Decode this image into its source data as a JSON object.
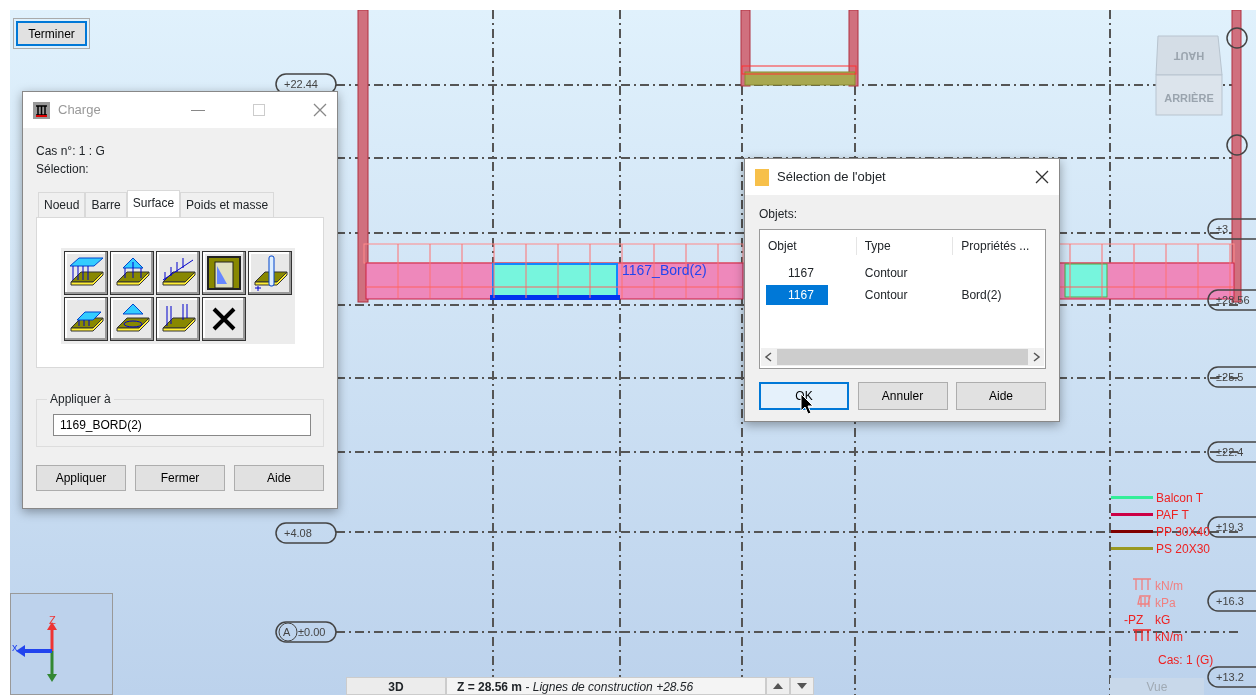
{
  "finish_button": "Terminer",
  "left_level_tags": [
    {
      "label": "+22.44"
    },
    {
      "label": "+4.08"
    },
    {
      "label": "±0.00",
      "bubble": "A"
    }
  ],
  "right_level_tags": [
    {
      "label": "±3"
    },
    {
      "label": "±28.56"
    },
    {
      "label": "±25.5"
    },
    {
      "label": "±22.4"
    },
    {
      "label": "±19.3"
    },
    {
      "label": "+16.3"
    },
    {
      "label": "+13.2"
    }
  ],
  "beam_label": "1167_Bord(2)",
  "view_cube": {
    "top": "HAUT",
    "face": "ARRIÈRE"
  },
  "legend": [
    {
      "label": "Balcon T",
      "color": "#33ee99"
    },
    {
      "label": "PAF T",
      "color": "#cc0044"
    },
    {
      "label": "PP 30X40",
      "color": "#800000"
    },
    {
      "label": "PS 20X30",
      "color": "#999922"
    }
  ],
  "units": [
    {
      "kind": "linear",
      "label": "kN/m",
      "faded": true
    },
    {
      "kind": "surface",
      "label": "kPa",
      "faded": true
    },
    {
      "kind": "point",
      "prefix": "-PZ",
      "label": "kG",
      "faded": false
    },
    {
      "kind": "linear",
      "label": "kN/m",
      "faded": false
    }
  ],
  "case_label": "Cas: 1 (G)",
  "view_label": "Vue",
  "axes": {
    "z": "Z",
    "x": "x"
  },
  "status_bar": {
    "mode": "3D",
    "plane": "**Z = 28.56 m** - *Lignes de construction +28.56*"
  },
  "charge_dialog": {
    "title": "Charge",
    "case": "Cas n°: 1 : G",
    "selection_label": "Sélection:",
    "tabs": [
      {
        "label": "Noeud",
        "selected": false
      },
      {
        "label": "Barre",
        "selected": false
      },
      {
        "label": "Surface",
        "selected": true
      },
      {
        "label": "Poids et masse",
        "selected": false
      }
    ],
    "tools": [
      {
        "kind": "uniform"
      },
      {
        "kind": "point"
      },
      {
        "kind": "linear"
      },
      {
        "kind": "hydrostatic"
      },
      {
        "kind": "thermal"
      },
      {
        "kind": "contour"
      },
      {
        "kind": "point-contour"
      },
      {
        "kind": "edge"
      },
      {
        "kind": "delete"
      }
    ],
    "apply_group": {
      "legend": "Appliquer à",
      "value": "1169_BORD(2)"
    },
    "buttons": [
      "Appliquer",
      "Fermer",
      "Aide"
    ]
  },
  "selection_dialog": {
    "title": "Sélection de l'objet",
    "list_label": "Objets:",
    "columns": [
      "Objet",
      "Type",
      "Propriétés ..."
    ],
    "rows": [
      {
        "cells": [
          "1167",
          "Contour",
          ""
        ],
        "selected": false
      },
      {
        "cells": [
          "1167",
          "Contour",
          "Bord(2)"
        ],
        "selected": true
      }
    ],
    "buttons": [
      {
        "label": "OK",
        "focused": true
      },
      {
        "label": "Annuler",
        "focused": false
      },
      {
        "label": "Aide",
        "focused": false
      }
    ]
  }
}
